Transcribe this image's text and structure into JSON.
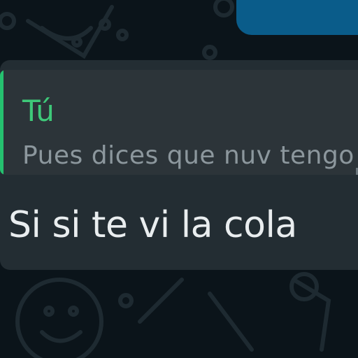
{
  "chat": {
    "quoted_reply": {
      "author": "Tú",
      "text": "Pues dices que nuv tengo"
    },
    "message": {
      "text": "Si si te vi la cola"
    }
  },
  "colors": {
    "background": "#0b141a",
    "incoming_bubble": "#232d33",
    "quote_box": "#2c3439",
    "quote_accent": "#25c16f",
    "outgoing_bubble": "#0a5c8a",
    "message_text": "#e9edef",
    "quote_text": "#8c979d"
  }
}
